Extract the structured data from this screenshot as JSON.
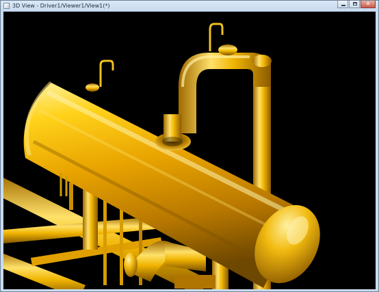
{
  "window": {
    "title": "3D View - Driver1/Viewer1/View1(*)",
    "icon": "app-window-icon",
    "controls": {
      "minimize_icon": "minimize-icon",
      "maximize_icon": "maximize-icon",
      "close_icon": "close-icon",
      "close_glyph": "✕"
    }
  },
  "viewport": {
    "background_color": "#000000",
    "model_color": "#e8a800",
    "highlight_color": "#ffe36a",
    "shadow_color": "#7a4f00",
    "scene": "3d-piping-model"
  }
}
